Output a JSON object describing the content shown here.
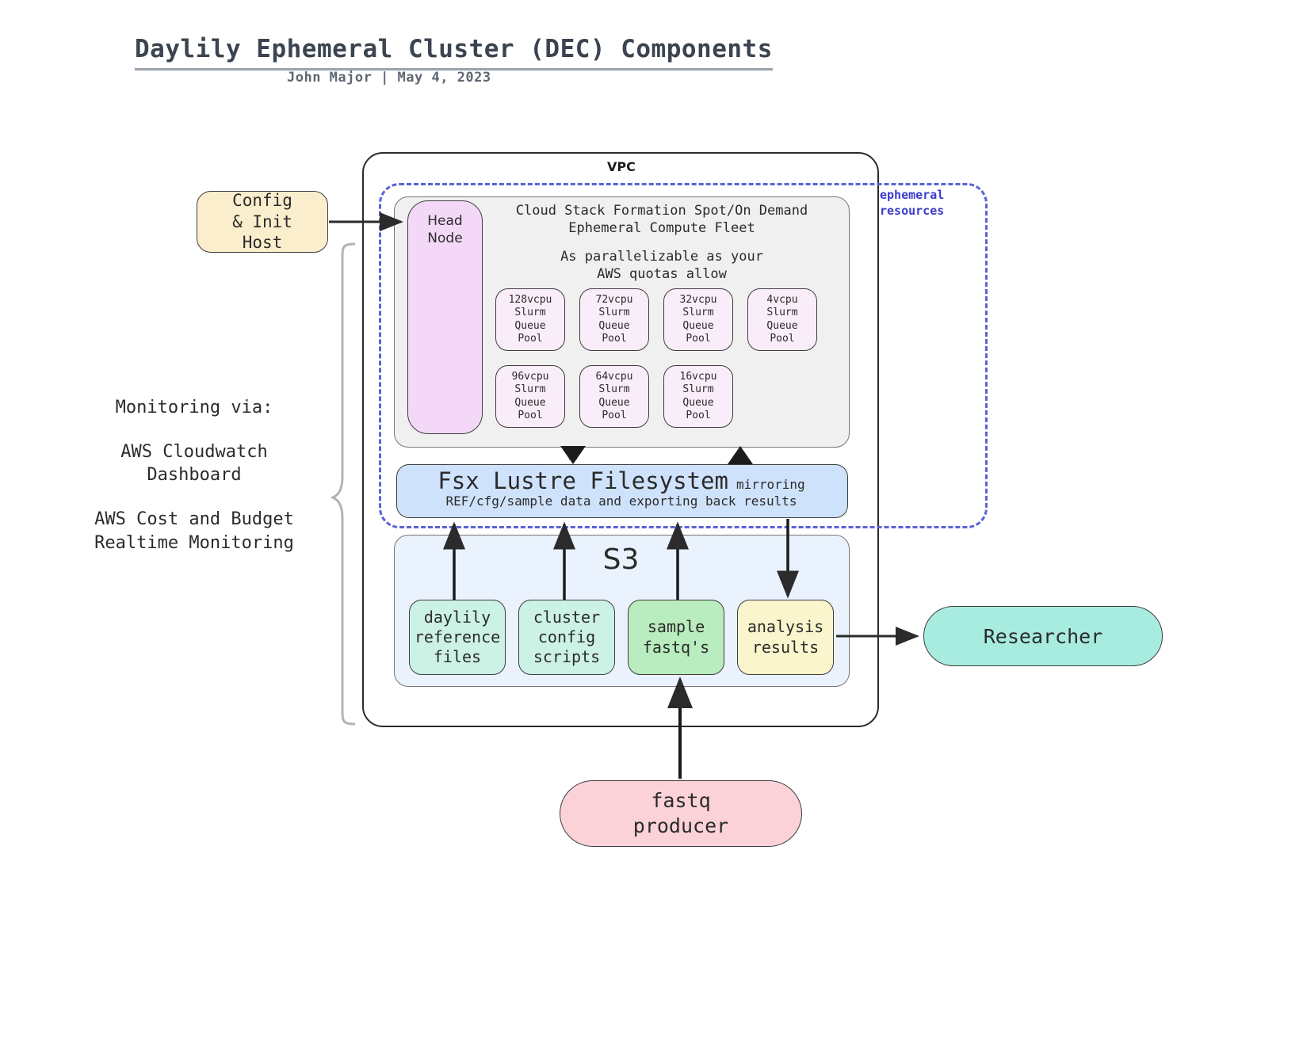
{
  "header": {
    "title": "Daylily Ephemeral Cluster (DEC) Components",
    "subtitle": "John Major  |  May 4, 2023"
  },
  "vpc": {
    "label": "VPC"
  },
  "ephemeral": {
    "label": "ephemeral\nresources",
    "border_color": "#5b63d6"
  },
  "config_host": {
    "label": "Config\n& Init\nHost",
    "color": "#fbeecd"
  },
  "fleet": {
    "head_node": "Head\nNode",
    "head_node_color": "#f3d9f7",
    "title": "Cloud Stack Formation Spot/On Demand\nEphemeral Compute Fleet",
    "subtitle": "As parallelizable as your\nAWS quotas allow",
    "background": "#f0f0f0",
    "pool_color": "#faedfa",
    "pools_row1": [
      "128vcpu\nSlurm\nQueue\nPool",
      "72vcpu\nSlurm\nQueue\nPool",
      "32vcpu\nSlurm\nQueue\nPool",
      "4vcpu\nSlurm\nQueue\nPool"
    ],
    "pools_row2": [
      "96vcpu\nSlurm\nQueue\nPool",
      "64vcpu\nSlurm\nQueue\nPool",
      "16vcpu\nSlurm\nQueue\nPool"
    ]
  },
  "fsx": {
    "title": "Fsx Lustre Filesystem",
    "mirroring": "mirroring",
    "detail": "REF/cfg/sample data and exporting back results",
    "color": "#cfe2fb"
  },
  "s3": {
    "label": "S3",
    "background": "#eaf2fe",
    "items": [
      {
        "label": "daylily\nreference\nfiles",
        "color": "#ccf2e6"
      },
      {
        "label": "cluster\nconfig\nscripts",
        "color": "#ccf2e6"
      },
      {
        "label": "sample\nfastq's",
        "color": "#b9ecbe"
      },
      {
        "label": "analysis\nresults",
        "color": "#faf5cd"
      }
    ]
  },
  "researcher": {
    "label": "Researcher",
    "color": "#a8ece0"
  },
  "fastq_producer": {
    "label": "fastq\nproducer",
    "color": "#fbd2d8"
  },
  "monitoring": {
    "heading": "Monitoring via:",
    "line1": "AWS Cloudwatch\nDashboard",
    "line2": "AWS Cost and Budget\nRealtime Monitoring"
  }
}
